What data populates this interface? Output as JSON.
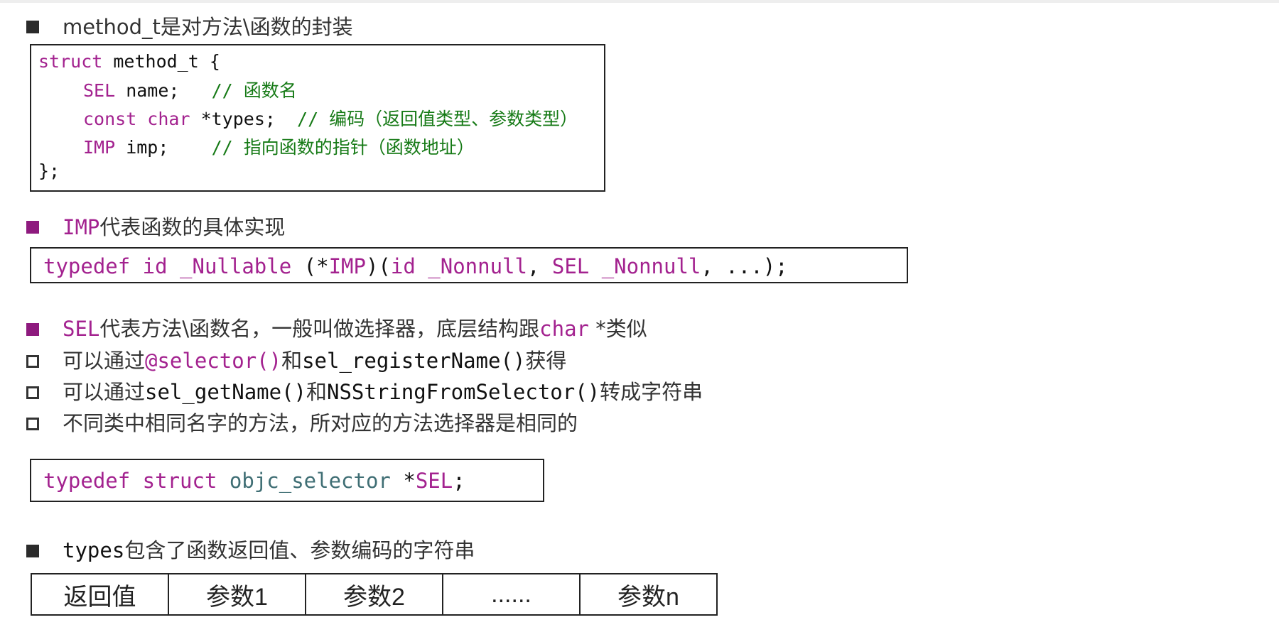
{
  "sections": {
    "method": {
      "title": "method_t是对方法\\函数的封装",
      "code": {
        "l1_kw": "struct",
        "l1_rest": " method_t {",
        "l2_type": "SEL",
        "l2_rest": " name;   ",
        "l2_comment": "// 函数名",
        "l3_type": "const char",
        "l3_rest": " *types;  ",
        "l3_comment": "// 编码（返回值类型、参数类型）",
        "l4_type": "IMP",
        "l4_rest": " imp;    ",
        "l4_comment": "// 指向函数的指针（函数地址）",
        "l5": "};"
      }
    },
    "imp": {
      "title_code": "IMP",
      "title_text": "代表函数的具体实现",
      "code": {
        "t1": "typedef id _Nullable ",
        "t2": "(*",
        "t3": "IMP",
        "t4": ")(",
        "t5": "id _Nonnull",
        "t6": ", ",
        "t7": "SEL _Nonnull",
        "t8": ", ...);"
      }
    },
    "sel": {
      "title_code": "SEL",
      "title_text": "代表方法\\函数名，一般叫做选择器，底层结构跟",
      "title_code2": "char",
      "title_text2": " *类似",
      "items": [
        {
          "a": "可以通过",
          "b": "@selector()",
          "c": "和",
          "d": "sel_registerName()",
          "e": "获得"
        },
        {
          "a": "可以通过",
          "b": "sel_getName()",
          "c": "和",
          "d": "NSStringFromSelector()",
          "e": "转成字符串"
        },
        {
          "a": "不同类中相同名字的方法，所对应的方法选择器是相同的"
        }
      ],
      "code": {
        "t1": "typedef struct ",
        "t2": "objc_selector",
        "t3": " *",
        "t4": "SEL",
        "t5": ";"
      }
    },
    "types": {
      "title_code": "types",
      "title_text": "包含了函数返回值、参数编码的字符串",
      "cells": [
        "返回值",
        "参数1",
        "参数2",
        "......",
        "参数n"
      ]
    }
  },
  "colors": {
    "keyword": "#a3228f",
    "comment": "#167a16",
    "type_name": "#3f6e74",
    "bullet_magenta": "#8e1a7e",
    "bullet_black": "#2b2b2b"
  }
}
